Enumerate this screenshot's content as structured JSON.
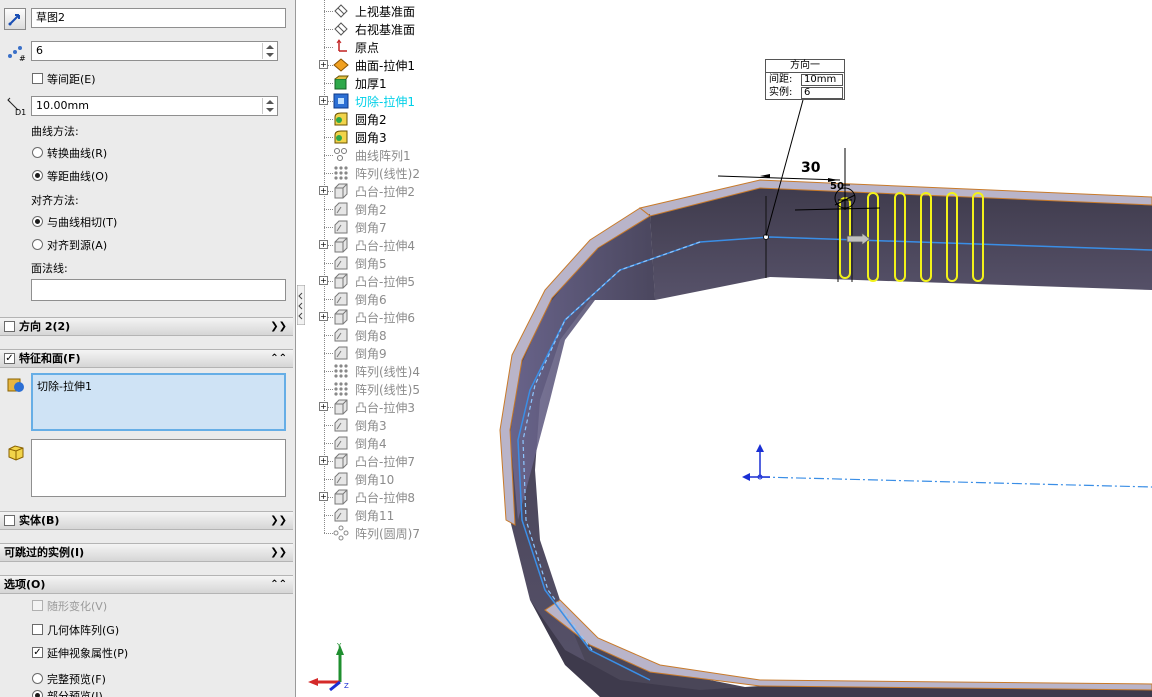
{
  "pm": {
    "sketch_field": "草图2",
    "instances_value": "6",
    "equal_spacing_label": "等间距(E)",
    "spacing_value": "10.00mm",
    "curve_method_label": "曲线方法:",
    "curve_options": [
      "转换曲线(R)",
      "等距曲线(O)"
    ],
    "align_method_label": "对齐方法:",
    "align_options": [
      "与曲线相切(T)",
      "对齐到源(A)"
    ],
    "face_normal_label": "面法线:",
    "direction2_header": "方向 2(2)",
    "features_header": "特征和面(F)",
    "features_list_item": "切除-拉伸1",
    "bodies_header": "实体(B)",
    "skip_header": "可跳过的实例(I)",
    "options_header": "选项(O)",
    "opt_vary": "随形变化(V)",
    "opt_geometry": "几何体阵列(G)",
    "opt_propagate": "延伸视象属性(P)",
    "opt_full_preview": "完整预览(F)",
    "opt_partial_preview": "部分预览(I)"
  },
  "tree": [
    {
      "label": "上视基准面",
      "icon": "plane-icon",
      "style": "normal",
      "expand": false
    },
    {
      "label": "右视基准面",
      "icon": "plane-icon",
      "style": "normal",
      "expand": false
    },
    {
      "label": "原点",
      "icon": "origin-icon",
      "style": "normal",
      "expand": false
    },
    {
      "label": "曲面-拉伸1",
      "icon": "surface-extrude-icon",
      "style": "normal",
      "expand": true
    },
    {
      "label": "加厚1",
      "icon": "thicken-icon",
      "style": "normal",
      "expand": false
    },
    {
      "label": "切除-拉伸1",
      "icon": "cut-extrude-icon",
      "style": "cyan",
      "expand": true
    },
    {
      "label": "圆角2",
      "icon": "fillet-icon",
      "style": "normal",
      "expand": false
    },
    {
      "label": "圆角3",
      "icon": "fillet-icon",
      "style": "normal",
      "expand": false
    },
    {
      "label": "曲线阵列1",
      "icon": "curve-pattern-icon",
      "style": "grey",
      "expand": false
    },
    {
      "label": "阵列(线性)2",
      "icon": "linear-pattern-icon",
      "style": "grey",
      "expand": false
    },
    {
      "label": "凸台-拉伸2",
      "icon": "boss-extrude-icon",
      "style": "grey",
      "expand": true
    },
    {
      "label": "倒角2",
      "icon": "chamfer-icon",
      "style": "grey",
      "expand": false
    },
    {
      "label": "倒角7",
      "icon": "chamfer-icon",
      "style": "grey",
      "expand": false
    },
    {
      "label": "凸台-拉伸4",
      "icon": "boss-extrude-icon",
      "style": "grey",
      "expand": true
    },
    {
      "label": "倒角5",
      "icon": "chamfer-icon",
      "style": "grey",
      "expand": false
    },
    {
      "label": "凸台-拉伸5",
      "icon": "boss-extrude-icon",
      "style": "grey",
      "expand": true
    },
    {
      "label": "倒角6",
      "icon": "chamfer-icon",
      "style": "grey",
      "expand": false
    },
    {
      "label": "凸台-拉伸6",
      "icon": "boss-extrude-icon",
      "style": "grey",
      "expand": true
    },
    {
      "label": "倒角8",
      "icon": "chamfer-icon",
      "style": "grey",
      "expand": false
    },
    {
      "label": "倒角9",
      "icon": "chamfer-icon",
      "style": "grey",
      "expand": false
    },
    {
      "label": "阵列(线性)4",
      "icon": "linear-pattern-icon",
      "style": "grey",
      "expand": false
    },
    {
      "label": "阵列(线性)5",
      "icon": "linear-pattern-icon",
      "style": "grey",
      "expand": false
    },
    {
      "label": "凸台-拉伸3",
      "icon": "boss-extrude-icon",
      "style": "grey",
      "expand": true
    },
    {
      "label": "倒角3",
      "icon": "chamfer-icon",
      "style": "grey",
      "expand": false
    },
    {
      "label": "倒角4",
      "icon": "chamfer-icon",
      "style": "grey",
      "expand": false
    },
    {
      "label": "凸台-拉伸7",
      "icon": "boss-extrude-icon",
      "style": "grey",
      "expand": true
    },
    {
      "label": "倒角10",
      "icon": "chamfer-icon",
      "style": "grey",
      "expand": false
    },
    {
      "label": "凸台-拉伸8",
      "icon": "boss-extrude-icon",
      "style": "grey",
      "expand": true
    },
    {
      "label": "倒角11",
      "icon": "chamfer-icon",
      "style": "grey",
      "expand": false
    },
    {
      "label": "阵列(圆周)7",
      "icon": "circular-pattern-icon",
      "style": "grey",
      "expand": false
    }
  ],
  "viewport": {
    "callout_title": "方向一",
    "callout_spacing_label": "间距:",
    "callout_spacing_value": "10mm",
    "callout_instances_label": "实例:",
    "callout_instances_value": "6",
    "dimension_label": "30",
    "dimension_small": "50"
  },
  "colors": {
    "part_face": "#4a4658",
    "part_top": "#b8b3c8",
    "edge": "#c87a2a",
    "preview": "#f2f21a",
    "path_curve": "#3a8ee6",
    "selection": "#00d0e8"
  }
}
